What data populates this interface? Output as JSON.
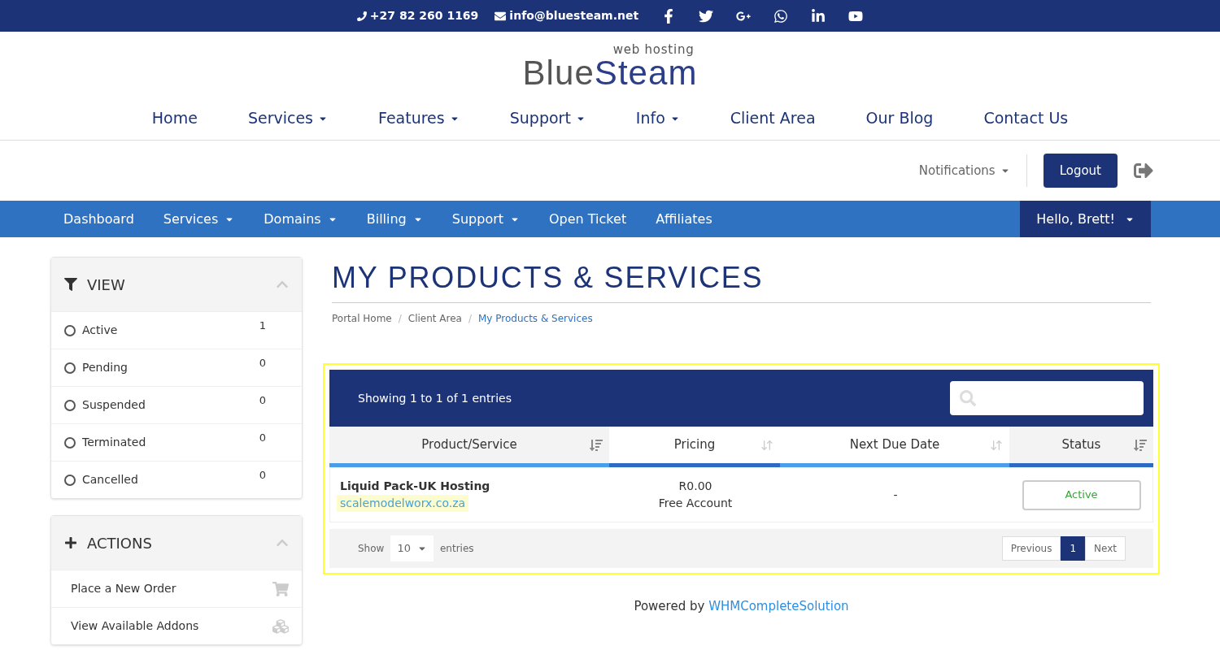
{
  "topbar": {
    "phone": "+27 82 260 1169",
    "email": "info@bluesteam.net",
    "social": [
      {
        "kind": "facebook"
      },
      {
        "kind": "twitter"
      },
      {
        "kind": "google-plus"
      },
      {
        "kind": "whatsapp"
      },
      {
        "kind": "linkedin"
      },
      {
        "kind": "youtube"
      }
    ]
  },
  "logo": {
    "first": "Blue",
    "second": "Steam",
    "tagline": "web hosting"
  },
  "main_nav": [
    {
      "label": "Home",
      "has_dropdown": false
    },
    {
      "label": "Services",
      "has_dropdown": true
    },
    {
      "label": "Features",
      "has_dropdown": true
    },
    {
      "label": "Support",
      "has_dropdown": true
    },
    {
      "label": "Info",
      "has_dropdown": true
    },
    {
      "label": "Client Area",
      "has_dropdown": false
    },
    {
      "label": "Our Blog",
      "has_dropdown": false
    },
    {
      "label": "Contact Us",
      "has_dropdown": false
    }
  ],
  "account_bar": {
    "notifications": "Notifications",
    "logout": "Logout"
  },
  "client_nav": {
    "items": [
      {
        "label": "Dashboard",
        "has_dropdown": false
      },
      {
        "label": "Services",
        "has_dropdown": true
      },
      {
        "label": "Domains",
        "has_dropdown": true
      },
      {
        "label": "Billing",
        "has_dropdown": true
      },
      {
        "label": "Support",
        "has_dropdown": true
      },
      {
        "label": "Open Ticket",
        "has_dropdown": false
      },
      {
        "label": "Affiliates",
        "has_dropdown": false
      }
    ],
    "user": "Hello, Brett!"
  },
  "sidebar": {
    "view": {
      "title": "VIEW",
      "expanded": true,
      "items": [
        {
          "label": "Active",
          "count": "1",
          "selected": false
        },
        {
          "label": "Pending",
          "count": "0",
          "selected": false
        },
        {
          "label": "Suspended",
          "count": "0",
          "selected": false
        },
        {
          "label": "Terminated",
          "count": "0",
          "selected": false
        },
        {
          "label": "Cancelled",
          "count": "0",
          "selected": false
        }
      ]
    },
    "actions": {
      "title": "ACTIONS",
      "expanded": true,
      "items": [
        {
          "label": "Place a New Order",
          "kind": "cart"
        },
        {
          "label": "View Available Addons",
          "kind": "cubes"
        }
      ]
    }
  },
  "page": {
    "title": "MY PRODUCTS & SERVICES",
    "separator": "/",
    "breadcrumb": [
      {
        "label": "Portal Home",
        "selected": false
      },
      {
        "label": "Client Area",
        "selected": false
      },
      {
        "label": "My Products & Services",
        "selected": true
      }
    ]
  },
  "table": {
    "highlighted": true,
    "info": "Showing 1 to 1 of 1 entries",
    "columns": [
      {
        "label": "Product/Service",
        "sorted": true,
        "color": "#4a9de6"
      },
      {
        "label": "Pricing",
        "sorted": false,
        "color": "#2b6cc2"
      },
      {
        "label": "Next Due Date",
        "sorted": false,
        "color": "#4a9de6"
      },
      {
        "label": "Status",
        "sorted": true,
        "color": "#2b6cc2"
      }
    ],
    "rows": [
      {
        "product": "Liquid Pack-UK Hosting",
        "domain": "scalemodelworx.co.za",
        "price": "R0.00",
        "billing": "Free Account",
        "next_due": "-",
        "status": "Active"
      }
    ],
    "length": {
      "before": "Show",
      "value": "10",
      "after": "entries"
    },
    "pagination": [
      {
        "label": "Previous",
        "selected": false
      },
      {
        "label": "1",
        "selected": true
      },
      {
        "label": "Next",
        "selected": false
      }
    ]
  },
  "footer": {
    "text": "Powered by",
    "link": "WHMCompleteSolution"
  }
}
